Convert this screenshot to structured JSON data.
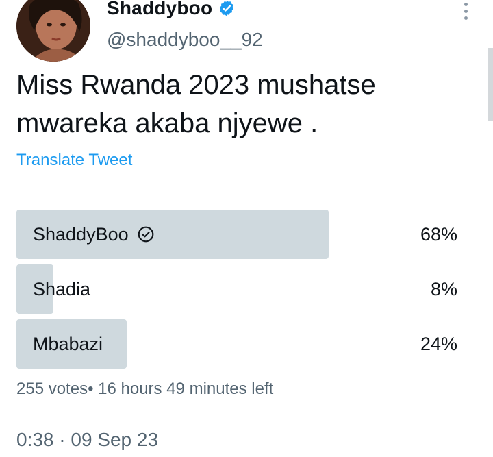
{
  "tweet": {
    "author": {
      "display_name": "Shaddyboo",
      "handle": "@shaddyboo__92",
      "verified": true,
      "avatar_icon": "profile-photo"
    },
    "text": "Miss Rwanda 2023 mushatse mwareka akaba njyewe .",
    "translate_label": "Translate Tweet",
    "poll": {
      "options": [
        {
          "label": "ShaddyBoo",
          "percent_label": "68%",
          "fraction": 0.68,
          "selected": true
        },
        {
          "label": "Shadia",
          "percent_label": "8%",
          "fraction": 0.08,
          "selected": false
        },
        {
          "label": "Mbabazi",
          "percent_label": "24%",
          "fraction": 0.24,
          "selected": false
        }
      ],
      "meta": "255 votes• 16 hours 49 minutes left"
    },
    "timestamp": "0:38 · 09 Sep 23"
  },
  "colors": {
    "link": "#1d9bf0",
    "verified": "#1d9bf0",
    "poll_bar": "#cfd9de",
    "secondary_text": "#536471"
  }
}
